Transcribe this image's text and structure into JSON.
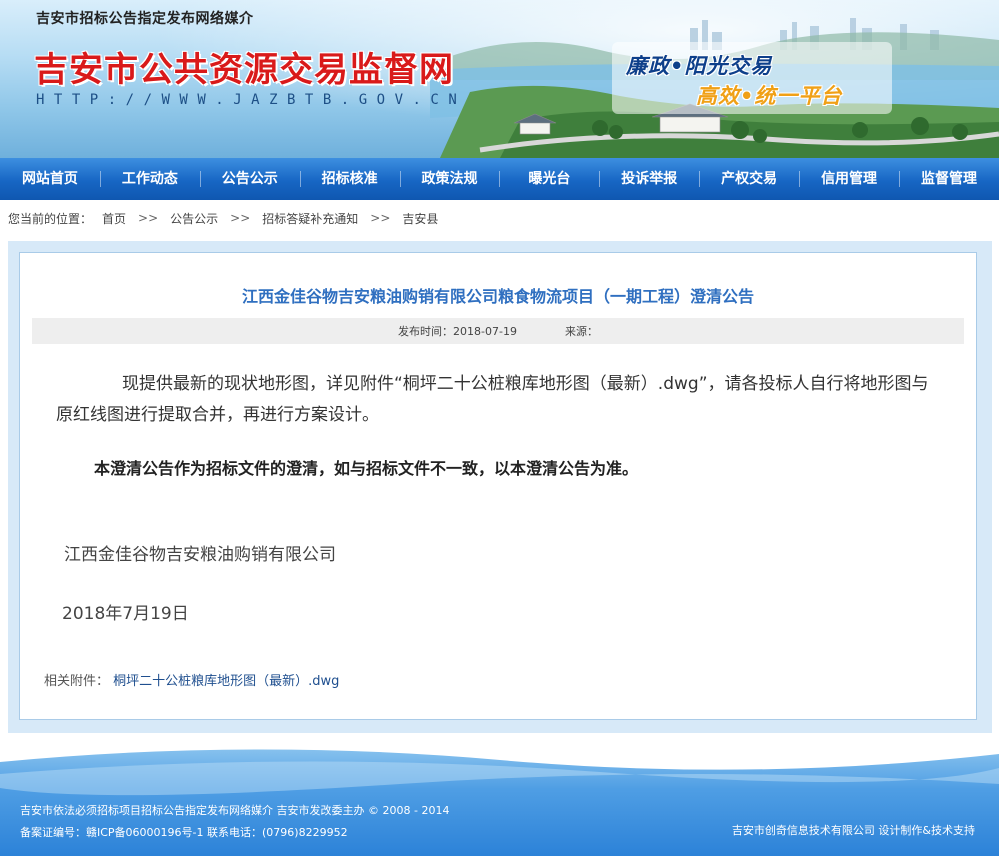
{
  "header": {
    "subtitle": "吉安市招标公告指定发布网络媒介",
    "site_title": "吉安市公共资源交易监督网",
    "site_url": "HTTP://WWW.JAZBTB.GOV.CN",
    "slogan_line1": "廉政•阳光交易",
    "slogan_line2": "高效•统一平台"
  },
  "nav": {
    "items": [
      {
        "label": "网站首页"
      },
      {
        "label": "工作动态"
      },
      {
        "label": "公告公示"
      },
      {
        "label": "招标核准"
      },
      {
        "label": "政策法规"
      },
      {
        "label": "曝光台"
      },
      {
        "label": "投诉举报"
      },
      {
        "label": "产权交易"
      },
      {
        "label": "信用管理"
      },
      {
        "label": "监督管理"
      }
    ]
  },
  "breadcrumb": {
    "prefix": "您当前的位置：",
    "items": [
      "首页",
      "公告公示",
      "招标答疑补充通知",
      "吉安县"
    ],
    "separator": ">>"
  },
  "article": {
    "title": "江西金佳谷物吉安粮油购销有限公司粮食物流项目（一期工程）澄清公告",
    "publish_label": "发布时间：",
    "publish_date": "2018-07-19",
    "source_label": "来源：",
    "source_value": "",
    "paragraph1": "现提供最新的现状地形图，详见附件“桐坪二十公桩粮库地形图（最新）.dwg”，请各投标人自行将地形图与原红线图进行提取合并，再进行方案设计。",
    "paragraph2": "本澄清公告作为招标文件的澄清，如与招标文件不一致，以本澄清公告为准。",
    "company": "江西金佳谷物吉安粮油购销有限公司",
    "date": "2018年7月19日",
    "attachment_label": "相关附件：",
    "attachment_name": "桐坪二十公桩粮库地形图（最新）.dwg"
  },
  "footer": {
    "line1": "吉安市依法必须招标项目招标公告指定发布网络媒介 吉安市发改委主办 © 2008 - 2014",
    "line2": "备案证编号：赣ICP备06000196号-1 联系电话：(0796)8229952",
    "right": "吉安市创奇信息技术有限公司 设计制作&技术支持"
  },
  "colors": {
    "title_red": "#d91a1a",
    "nav_blue": "#1766c4",
    "article_title_blue": "#2f6fc0",
    "slogan_blue": "#0d3f8a",
    "slogan_orange": "#f0a016"
  }
}
